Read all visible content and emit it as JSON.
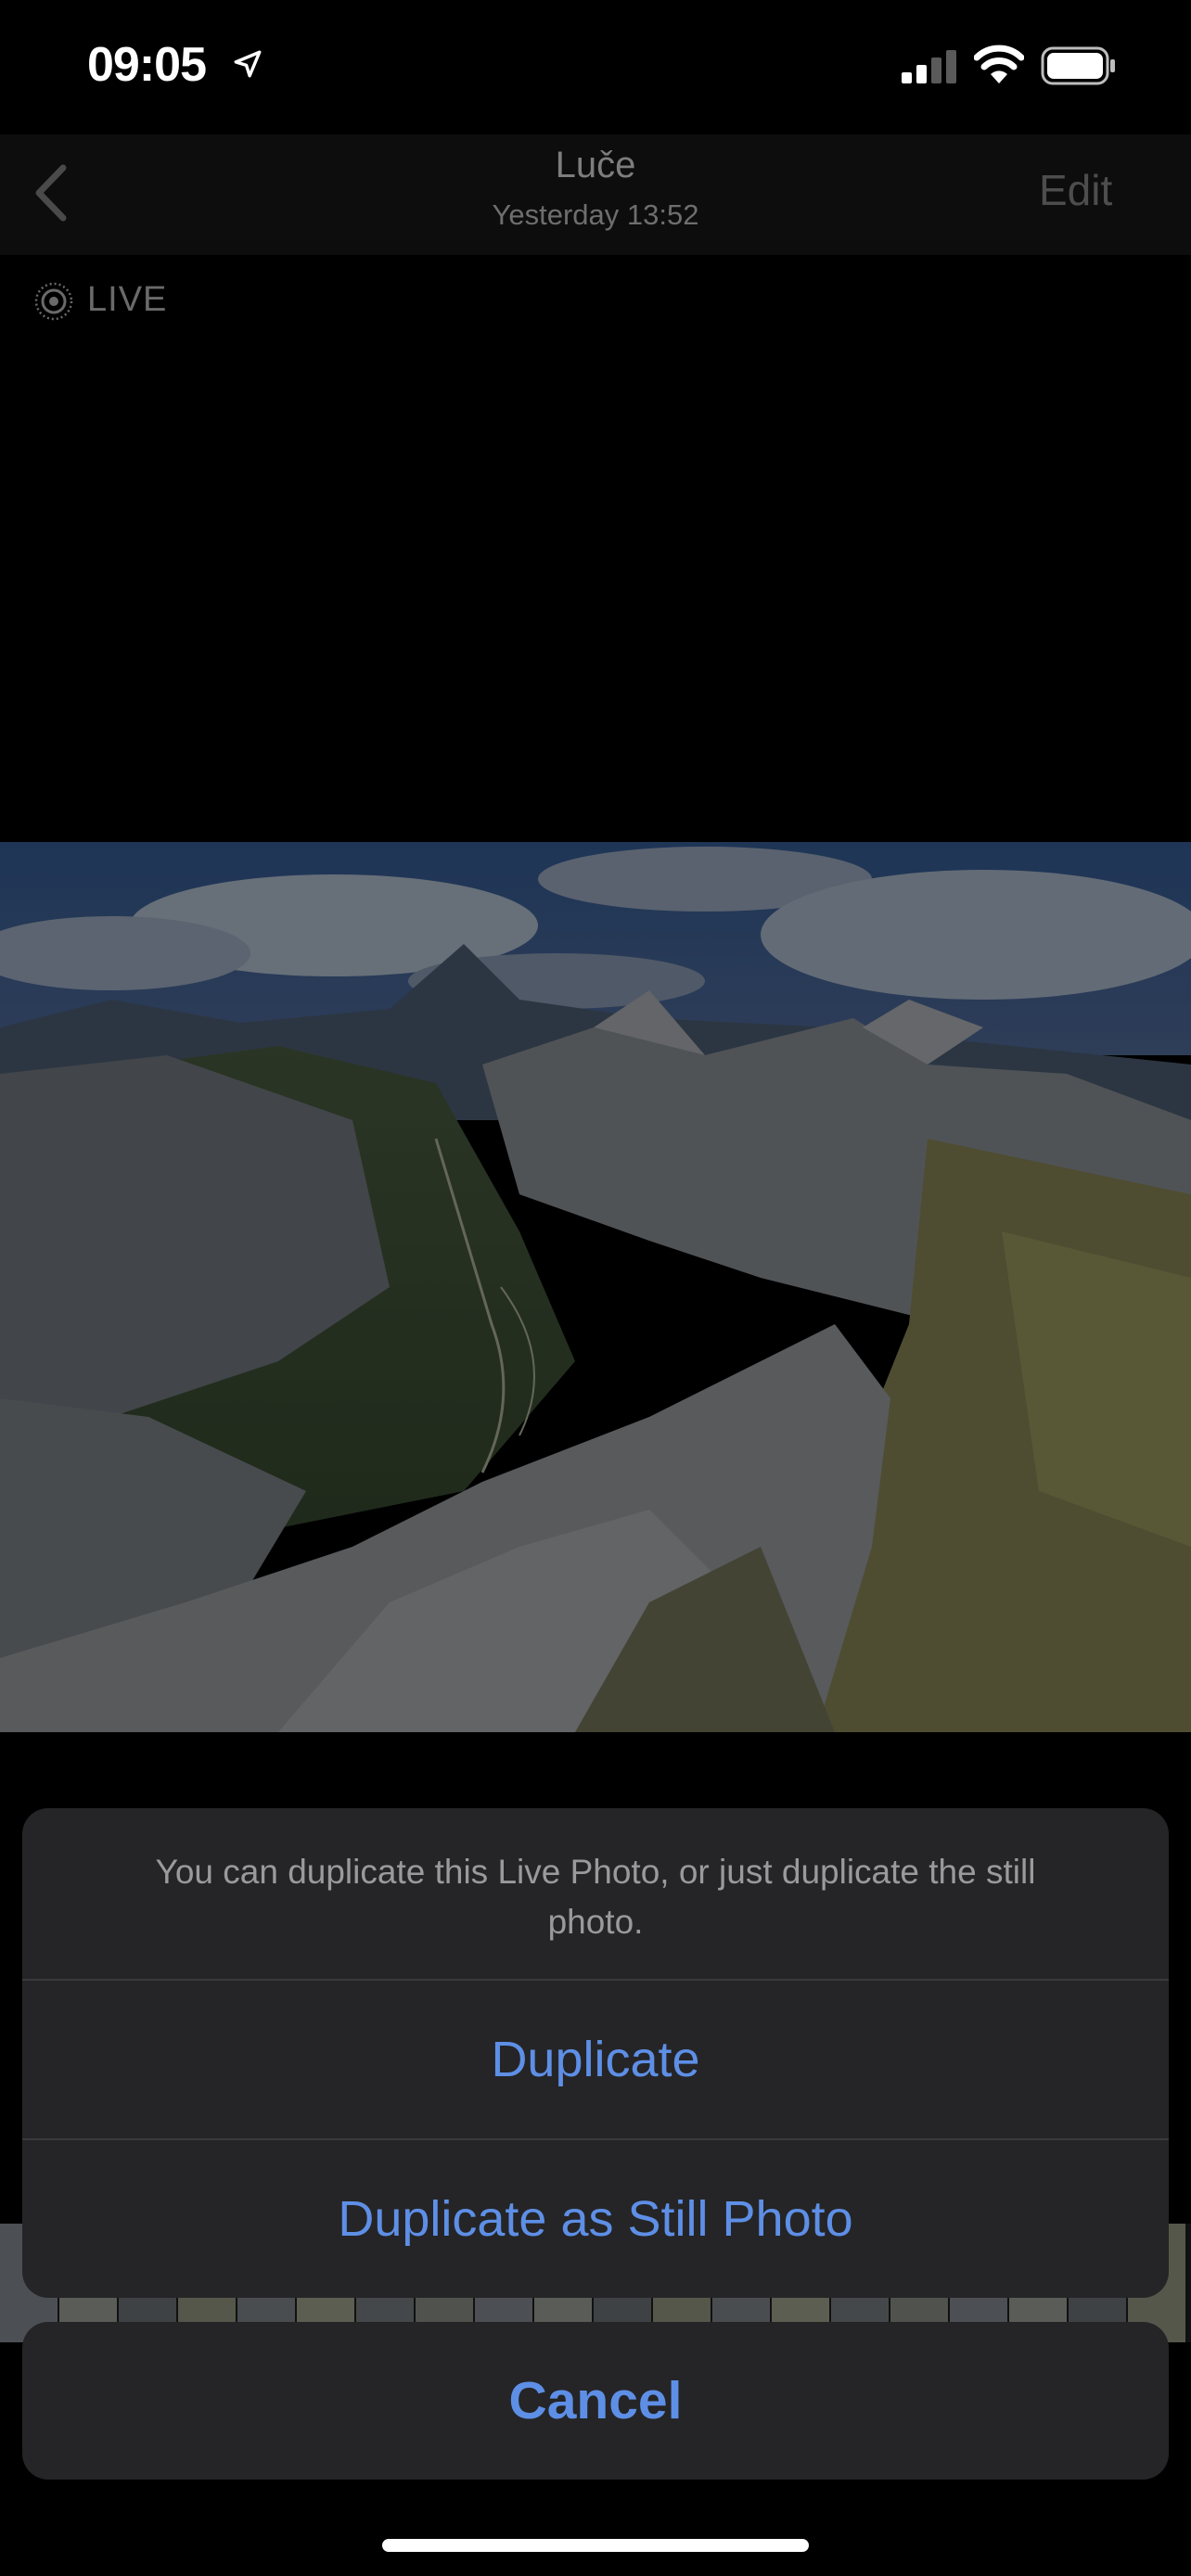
{
  "status_bar": {
    "time": "09:05",
    "icons": [
      "location-arrow-icon",
      "cellular-signal-icon",
      "wifi-icon",
      "battery-icon"
    ]
  },
  "nav": {
    "back_icon": "chevron-left-icon",
    "title": "Luče",
    "subtitle": "Yesterday  13:52",
    "edit_label": "Edit"
  },
  "live_badge": {
    "icon": "live-photo-icon",
    "label": "LIVE"
  },
  "photo": {
    "subject": "mountain-landscape"
  },
  "action_sheet": {
    "message": "You can duplicate this Live Photo, or just duplicate the still photo.",
    "duplicate_label": "Duplicate",
    "duplicate_still_label": "Duplicate as Still Photo",
    "cancel_label": "Cancel"
  },
  "colors": {
    "accent": "#5e8fe6",
    "sheet_background": "#252527",
    "separator": "#3a3a3c"
  }
}
